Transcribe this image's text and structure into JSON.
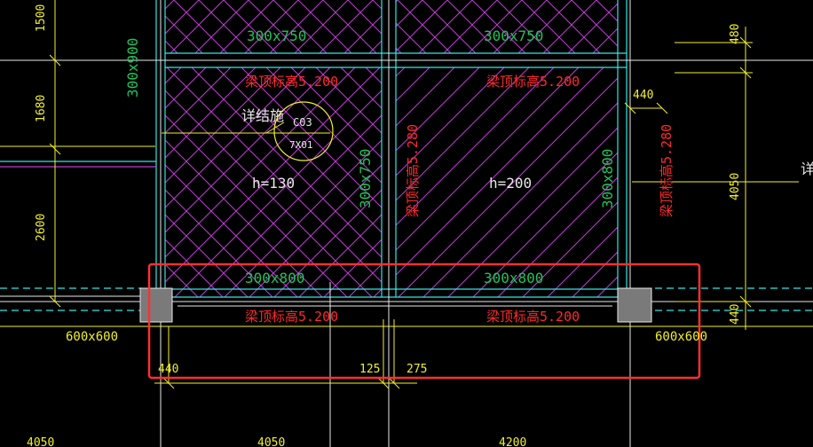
{
  "colors": {
    "background": "#000000",
    "grid_line": "#ffffff",
    "beam_cyan": "#32e6e6",
    "hatch_magenta": "#c23bd7",
    "label_green": "#22c35a",
    "label_red": "#ff2a2a",
    "dim_yellow": "#f2f02a",
    "column_gray": "#7a7a7a",
    "highlight_red": "#ff3030"
  },
  "beams_top": [
    {
      "size": "300x750"
    },
    {
      "size": "300x750"
    }
  ],
  "beam_elev_top": [
    {
      "text": "梁顶标高5.200"
    },
    {
      "text": "梁顶标高5.200"
    }
  ],
  "beams_vertical": [
    {
      "size": "300x900"
    },
    {
      "size": "300x750"
    },
    {
      "size": "300x800"
    }
  ],
  "beam_elev_vertical": [
    {
      "text": "梁顶标高5.280"
    },
    {
      "text": "梁顶标高5.280"
    }
  ],
  "slabs": [
    {
      "h": "h=130"
    },
    {
      "h": "h=200"
    }
  ],
  "detail_callout": {
    "leader_text": "详结施",
    "ref_top": "C03",
    "ref_bottom": "7X01",
    "right_fragment": "详"
  },
  "beams_bottom": [
    {
      "size": "300x800"
    },
    {
      "size": "300x800"
    }
  ],
  "beam_elev_bottom": [
    {
      "text": "梁顶标高5.200"
    },
    {
      "text": "梁顶标高5.200"
    }
  ],
  "columns": [
    {
      "size": "600x600"
    },
    {
      "size": "600x600"
    }
  ],
  "dims_left": [
    "1500",
    "1680",
    "2600"
  ],
  "dims_right": [
    "480",
    "4050",
    "440"
  ],
  "dim_top_right": "440",
  "dims_bottom": [
    "440",
    "125",
    "275"
  ],
  "dims_axis_bottom": [
    "4050",
    "4050",
    "4200"
  ]
}
